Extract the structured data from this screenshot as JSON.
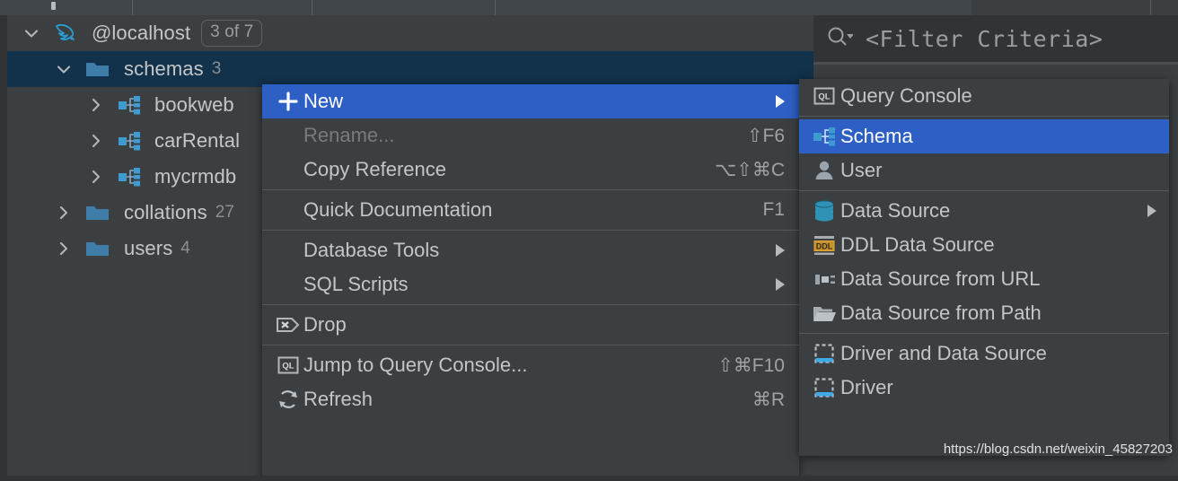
{
  "window": {
    "accent_blue": "#2d5fc4",
    "selection_navy": "#12314a",
    "panel_bg": "#3c3f41"
  },
  "tree": {
    "rows": [
      {
        "label": "@localhost",
        "icon": "mysql-dolphin-icon",
        "twisty": "chevron-down",
        "badge": "3 of 7",
        "count": "",
        "indent": 16,
        "selected": false
      },
      {
        "label": "schemas",
        "icon": "folder-icon",
        "twisty": "chevron-down",
        "badge": "",
        "count": "3",
        "indent": 52,
        "selected": true
      },
      {
        "label": "bookweb",
        "icon": "schema-icon",
        "twisty": "chevron-right",
        "badge": "",
        "count": "",
        "indent": 88,
        "selected": false
      },
      {
        "label": "carRental",
        "icon": "schema-icon",
        "twisty": "chevron-right",
        "badge": "",
        "count": "",
        "indent": 88,
        "selected": false
      },
      {
        "label": "mycrmdb",
        "icon": "schema-icon",
        "twisty": "chevron-right",
        "badge": "",
        "count": "",
        "indent": 88,
        "selected": false
      },
      {
        "label": "collations",
        "icon": "folder-icon",
        "twisty": "chevron-right",
        "badge": "",
        "count": "27",
        "indent": 52,
        "selected": false
      },
      {
        "label": "users",
        "icon": "folder-icon",
        "twisty": "chevron-right",
        "badge": "",
        "count": "4",
        "indent": 52,
        "selected": false
      }
    ]
  },
  "filter": {
    "placeholder": "<Filter Criteria>",
    "icon": "search-dropdown-icon"
  },
  "context_menu": {
    "items": [
      {
        "label": "New",
        "shortcut": "",
        "icon": "plus-icon",
        "submenu": true,
        "highlighted": true,
        "disabled": false
      },
      {
        "label": "Rename...",
        "shortcut": "⇧F6",
        "icon": "",
        "submenu": false,
        "highlighted": false,
        "disabled": true
      },
      {
        "label": "Copy Reference",
        "shortcut": "⌥⇧⌘C",
        "icon": "",
        "submenu": false,
        "highlighted": false,
        "disabled": false
      },
      {
        "separator": true
      },
      {
        "label": "Quick Documentation",
        "shortcut": "F1",
        "icon": "",
        "submenu": false,
        "highlighted": false,
        "disabled": false
      },
      {
        "separator": true
      },
      {
        "label": "Database Tools",
        "shortcut": "",
        "icon": "",
        "submenu": true,
        "highlighted": false,
        "disabled": false
      },
      {
        "label": "SQL Scripts",
        "shortcut": "",
        "icon": "",
        "submenu": true,
        "highlighted": false,
        "disabled": false
      },
      {
        "separator": true
      },
      {
        "label": "Drop",
        "shortcut": "",
        "icon": "drop-tag-icon",
        "submenu": false,
        "highlighted": false,
        "disabled": false
      },
      {
        "separator": true
      },
      {
        "label": "Jump to Query Console...",
        "shortcut": "⇧⌘F10",
        "icon": "query-console-icon",
        "submenu": false,
        "highlighted": false,
        "disabled": false
      },
      {
        "label": "Refresh",
        "shortcut": "⌘R",
        "icon": "refresh-icon",
        "submenu": false,
        "highlighted": false,
        "disabled": false
      }
    ]
  },
  "new_submenu": {
    "items": [
      {
        "label": "Query Console",
        "icon": "query-console-icon",
        "submenu": false,
        "highlighted": false
      },
      {
        "separator": true
      },
      {
        "label": "Schema",
        "icon": "schema-icon",
        "submenu": false,
        "highlighted": true
      },
      {
        "label": "User",
        "icon": "user-icon",
        "submenu": false,
        "highlighted": false
      },
      {
        "separator": true
      },
      {
        "label": "Data Source",
        "icon": "database-icon",
        "submenu": true,
        "highlighted": false
      },
      {
        "label": "DDL Data Source",
        "icon": "ddl-icon",
        "submenu": false,
        "highlighted": false
      },
      {
        "label": "Data Source from URL",
        "icon": "url-source-icon",
        "submenu": false,
        "highlighted": false
      },
      {
        "label": "Data Source from Path",
        "icon": "folder-open-icon",
        "submenu": false,
        "highlighted": false
      },
      {
        "separator": true
      },
      {
        "label": "Driver and Data Source",
        "icon": "driver-icon",
        "submenu": false,
        "highlighted": false
      },
      {
        "label": "Driver",
        "icon": "driver-icon",
        "submenu": false,
        "highlighted": false
      }
    ]
  },
  "watermark": {
    "text": "https://blog.csdn.net/weixin_45827203"
  }
}
